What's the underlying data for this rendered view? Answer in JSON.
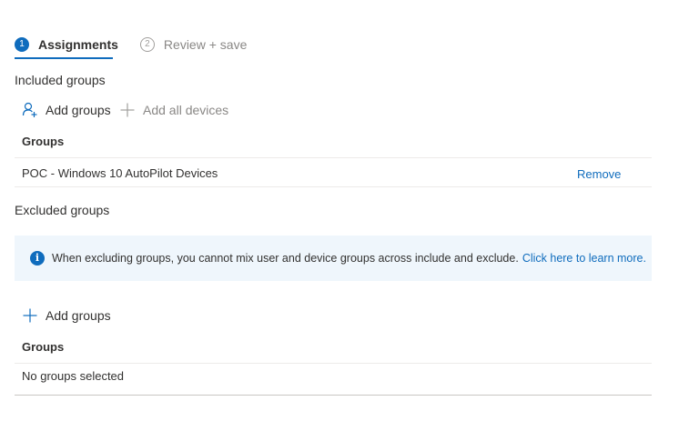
{
  "tabs": [
    {
      "number": "1",
      "label": "Assignments"
    },
    {
      "number": "2",
      "label": "Review + save"
    }
  ],
  "included": {
    "title": "Included groups",
    "add_groups_label": "Add groups",
    "add_all_devices_label": "Add all devices",
    "column_header": "Groups",
    "rows": [
      {
        "name": "POC - Windows 10 AutoPilot Devices",
        "action": "Remove"
      }
    ]
  },
  "excluded": {
    "title": "Excluded groups",
    "info_message": "When excluding groups, you cannot mix user and device groups across include and exclude.",
    "info_link": "Click here to learn more.",
    "add_groups_label": "Add groups",
    "column_header": "Groups",
    "empty_text": "No groups selected"
  },
  "colors": {
    "accent": "#0f6cbd",
    "info_background": "#eff6fc",
    "disabled_text": "#8a8886"
  }
}
